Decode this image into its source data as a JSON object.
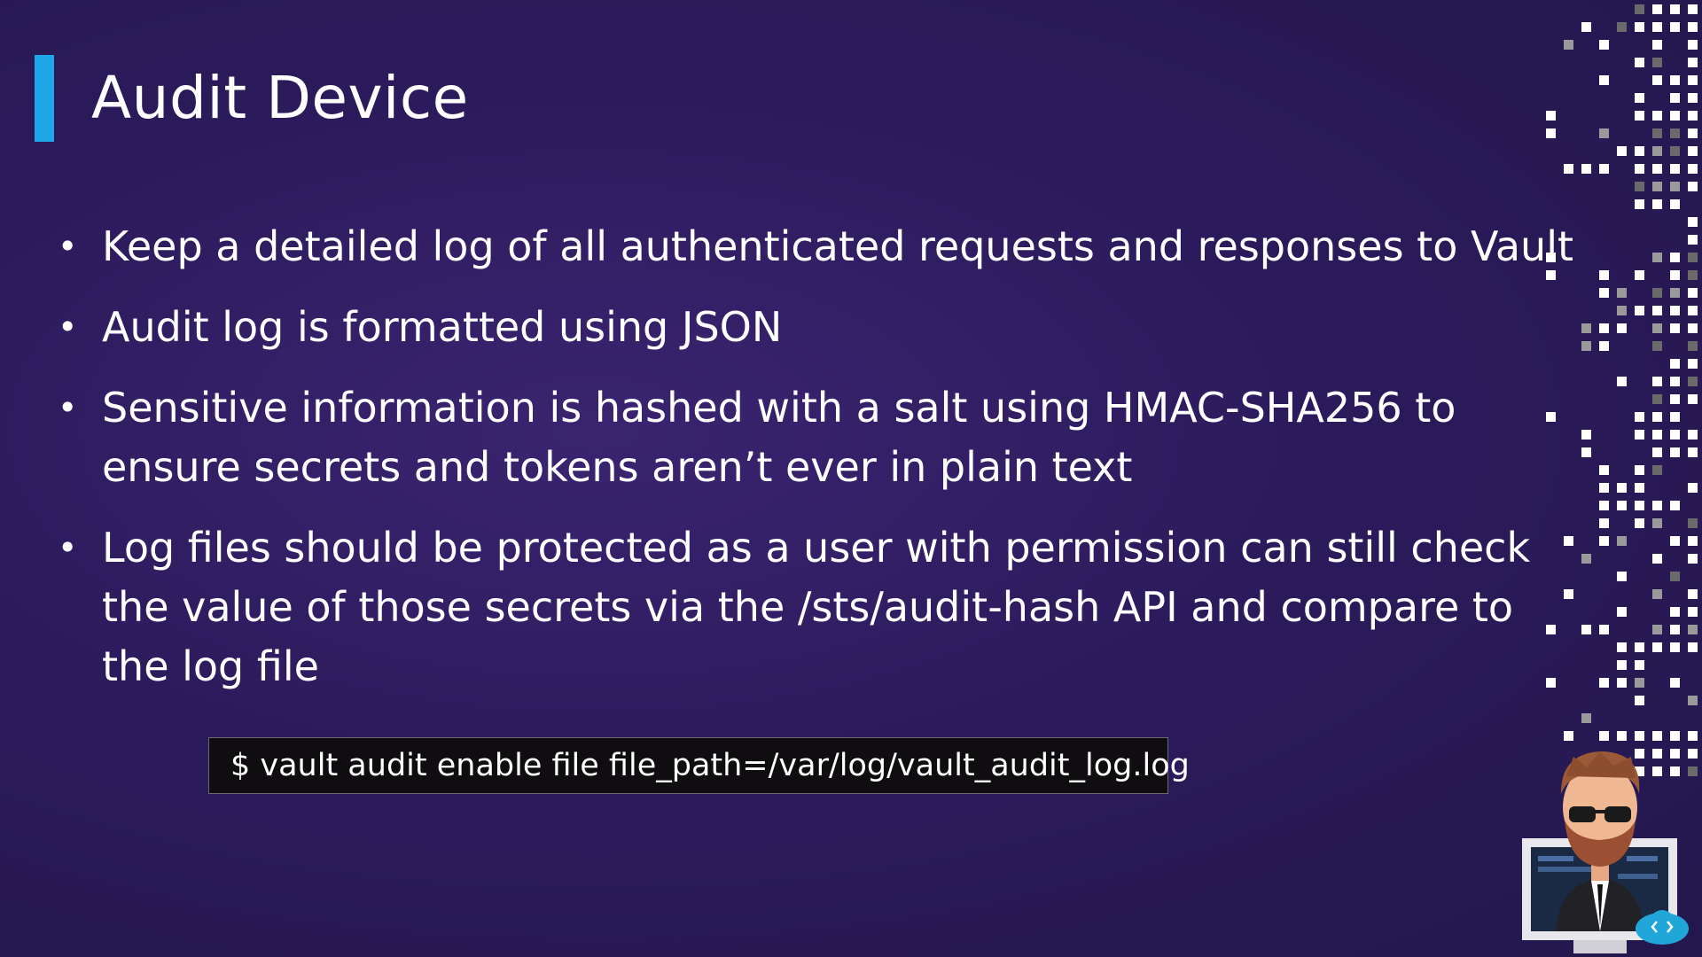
{
  "slide": {
    "title": "Audit Device",
    "bullets": [
      "Keep a detailed log of all authenticated requests and responses to Vault",
      "Audit log is formatted using JSON",
      "Sensitive information is hashed with a salt using HMAC-SHA256 to ensure secrets and tokens aren’t ever in plain text",
      "Log files should be protected as a user with permission can still check the value of those secrets via the /sts/audit-hash API and compare to the log file"
    ],
    "bullet_glyph": "•",
    "command": "$  vault audit enable file file_path=/var/log/vault_audit_log.log"
  },
  "colors": {
    "background": "#2c1b5c",
    "accent": "#1ea7e6",
    "text": "#ffffff",
    "command_bg": "#0f0d10"
  },
  "icons": {
    "decor": "pixel-pattern-icon",
    "mascot": "mascot-character-icon"
  }
}
